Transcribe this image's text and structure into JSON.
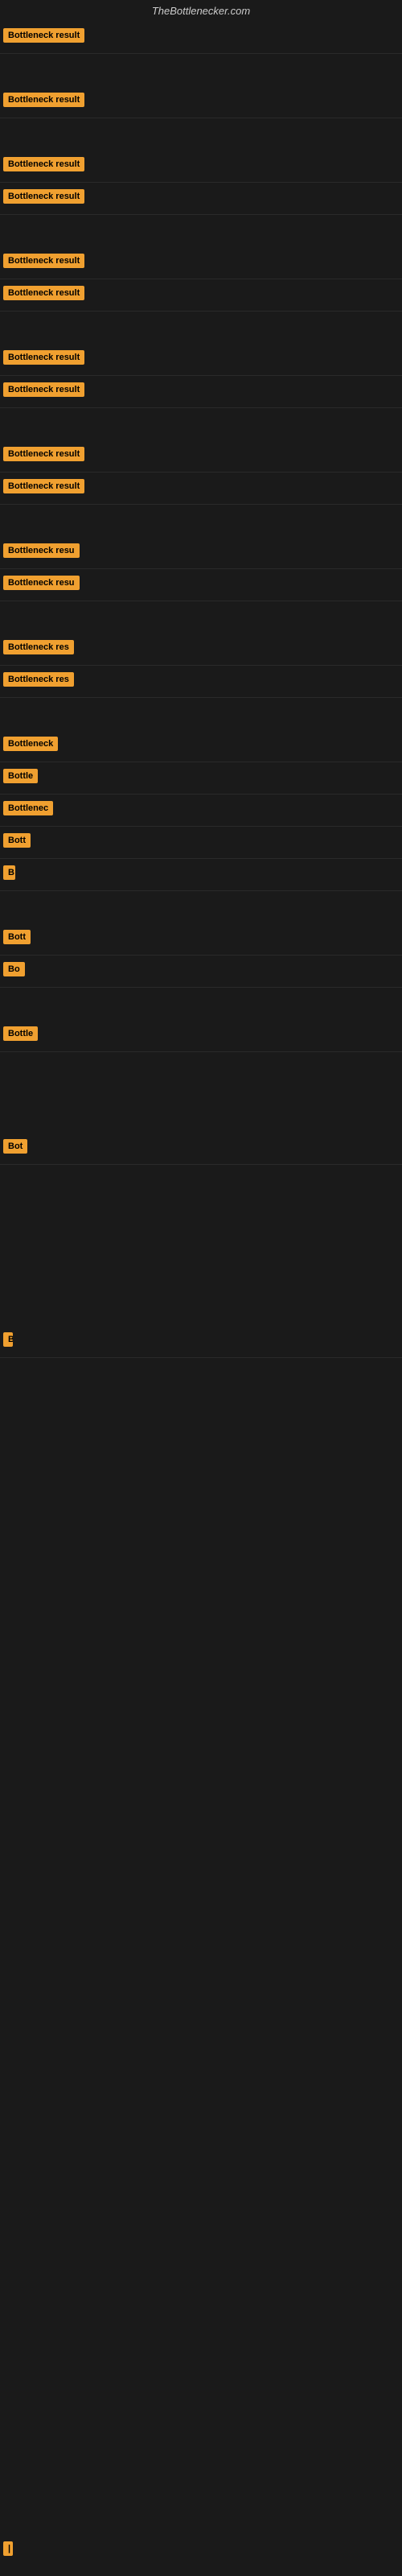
{
  "site": {
    "title": "TheBottlenecker.com"
  },
  "rows": [
    {
      "id": 1,
      "label": "Bottleneck result",
      "clip": "full"
    },
    {
      "id": 2,
      "label": "Bottleneck result",
      "clip": "full"
    },
    {
      "id": 3,
      "label": "Bottleneck result",
      "clip": "full"
    },
    {
      "id": 4,
      "label": "Bottleneck result",
      "clip": "full"
    },
    {
      "id": 5,
      "label": "Bottleneck result",
      "clip": "full"
    },
    {
      "id": 6,
      "label": "Bottleneck result",
      "clip": "full"
    },
    {
      "id": 7,
      "label": "Bottleneck result",
      "clip": "full"
    },
    {
      "id": 8,
      "label": "Bottleneck result",
      "clip": "full"
    },
    {
      "id": 9,
      "label": "Bottleneck result",
      "clip": "full"
    },
    {
      "id": 10,
      "label": "Bottleneck result",
      "clip": "full"
    },
    {
      "id": 11,
      "label": "Bottleneck resu",
      "clip": "clip-1"
    },
    {
      "id": 12,
      "label": "Bottleneck resu",
      "clip": "clip-1"
    },
    {
      "id": 13,
      "label": "Bottleneck res",
      "clip": "clip-2"
    },
    {
      "id": 14,
      "label": "Bottleneck res",
      "clip": "clip-2"
    },
    {
      "id": 15,
      "label": "Bottleneck",
      "clip": "clip-3"
    },
    {
      "id": 16,
      "label": "Bottle",
      "clip": "clip-4"
    },
    {
      "id": 17,
      "label": "Bottlenec",
      "clip": "clip-4"
    },
    {
      "id": 18,
      "label": "Bott",
      "clip": "clip-5"
    },
    {
      "id": 19,
      "label": "B",
      "clip": "clip-6"
    },
    {
      "id": 20,
      "label": "Bott",
      "clip": "clip-5"
    },
    {
      "id": 21,
      "label": "Bo",
      "clip": "clip-6"
    },
    {
      "id": 22,
      "label": "Bottle",
      "clip": "clip-4"
    },
    {
      "id": 23,
      "label": "Bot",
      "clip": "clip-5"
    },
    {
      "id": 24,
      "label": "B",
      "clip": "clip-7"
    }
  ]
}
